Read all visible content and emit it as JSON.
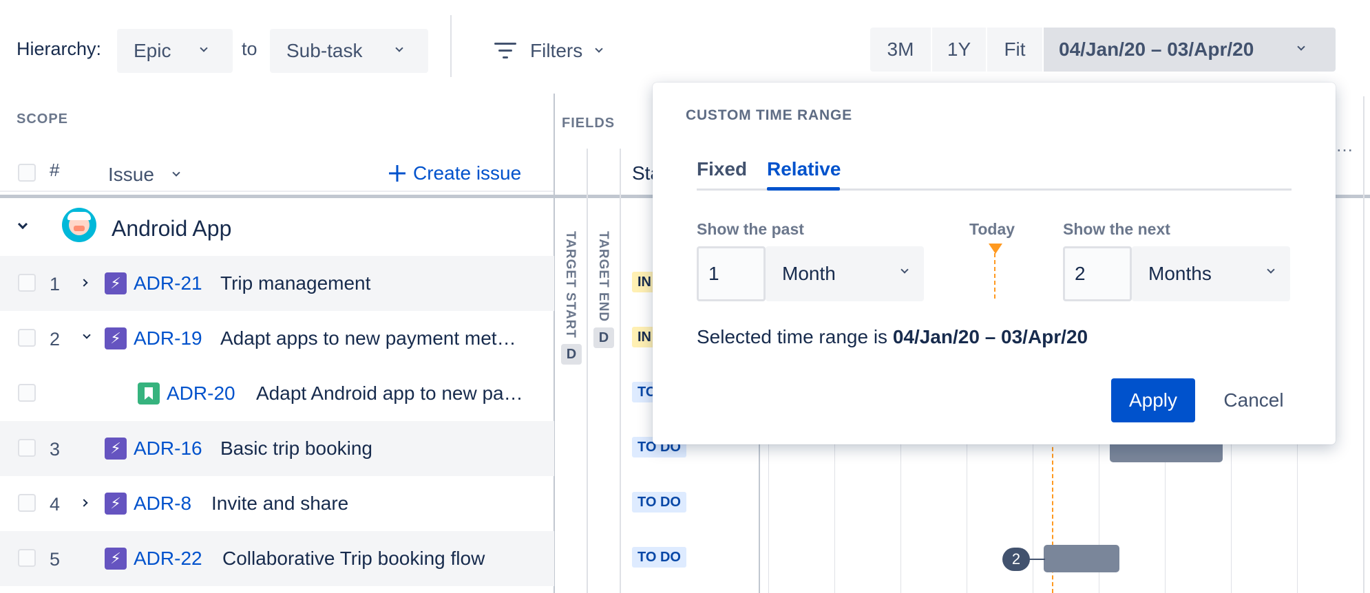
{
  "toolbar": {
    "hierarchy_label": "Hierarchy:",
    "from_value": "Epic",
    "to_label": "to",
    "to_value": "Sub-task",
    "filters_label": "Filters",
    "range_buttons": [
      "3M",
      "1Y",
      "Fit"
    ],
    "date_range": "04/Jan/20 – 03/Apr/20"
  },
  "scope": {
    "heading": "SCOPE",
    "col_number": "#",
    "col_issue": "Issue",
    "create_issue": "Create issue"
  },
  "fields": {
    "heading": "FIELDS",
    "target_start": "TARGET START",
    "target_end": "TARGET END",
    "date_chip": "D",
    "status_col_partial": "Sta"
  },
  "project": {
    "name": "Android App"
  },
  "rows": [
    {
      "num": "1",
      "key": "ADR-21",
      "title": "Trip management",
      "status": "IN",
      "expand": "right"
    },
    {
      "num": "2",
      "key": "ADR-19",
      "title": "Adapt apps to new payment met…",
      "status": "IN",
      "expand": "down"
    },
    {
      "num": "",
      "key": "ADR-20",
      "title": "Adapt Android app to new pa…",
      "status": "TO",
      "expand": ""
    },
    {
      "num": "3",
      "key": "ADR-16",
      "title": "Basic trip booking",
      "status": "TO DO",
      "expand": ""
    },
    {
      "num": "4",
      "key": "ADR-8",
      "title": "Invite and share",
      "status": "TO DO",
      "expand": "right"
    },
    {
      "num": "5",
      "key": "ADR-22",
      "title": "Collaborative Trip booking flow",
      "status": "TO DO",
      "expand": ""
    }
  ],
  "timeline": {
    "ellipsis": "…",
    "dependency_count": "2"
  },
  "popover": {
    "title": "CUSTOM TIME RANGE",
    "tabs": [
      "Fixed",
      "Relative"
    ],
    "selected_tab": "Relative",
    "past_label": "Show the past",
    "past_value": "1",
    "past_unit": "Month",
    "today_label": "Today",
    "next_label": "Show the next",
    "next_value": "2",
    "next_unit": "Months",
    "summary_prefix": "Selected time range is ",
    "summary_range": "04/Jan/20 – 03/Apr/20",
    "apply_label": "Apply",
    "cancel_label": "Cancel"
  },
  "colors": {
    "accent": "#0052cc",
    "epic": "#6554c0",
    "story": "#36b37e",
    "today_marker": "#ff991f",
    "bar": "#7a869a"
  }
}
